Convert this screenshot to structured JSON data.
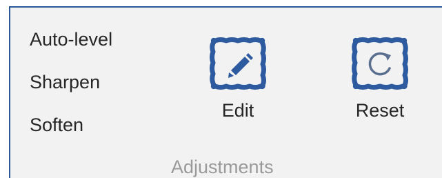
{
  "group": {
    "label": "Adjustments"
  },
  "side_items": [
    {
      "label": "Auto-level"
    },
    {
      "label": "Sharpen"
    },
    {
      "label": "Soften"
    }
  ],
  "buttons": {
    "edit": {
      "label": "Edit",
      "icon": "pencil-in-frame-icon"
    },
    "reset": {
      "label": "Reset",
      "icon": "refresh-in-frame-icon"
    }
  },
  "colors": {
    "accent": "#2b579a",
    "icon": "#2e5b9f",
    "text": "#262626",
    "muted": "#9a9a9a",
    "group_background": "#f2f2f2"
  }
}
